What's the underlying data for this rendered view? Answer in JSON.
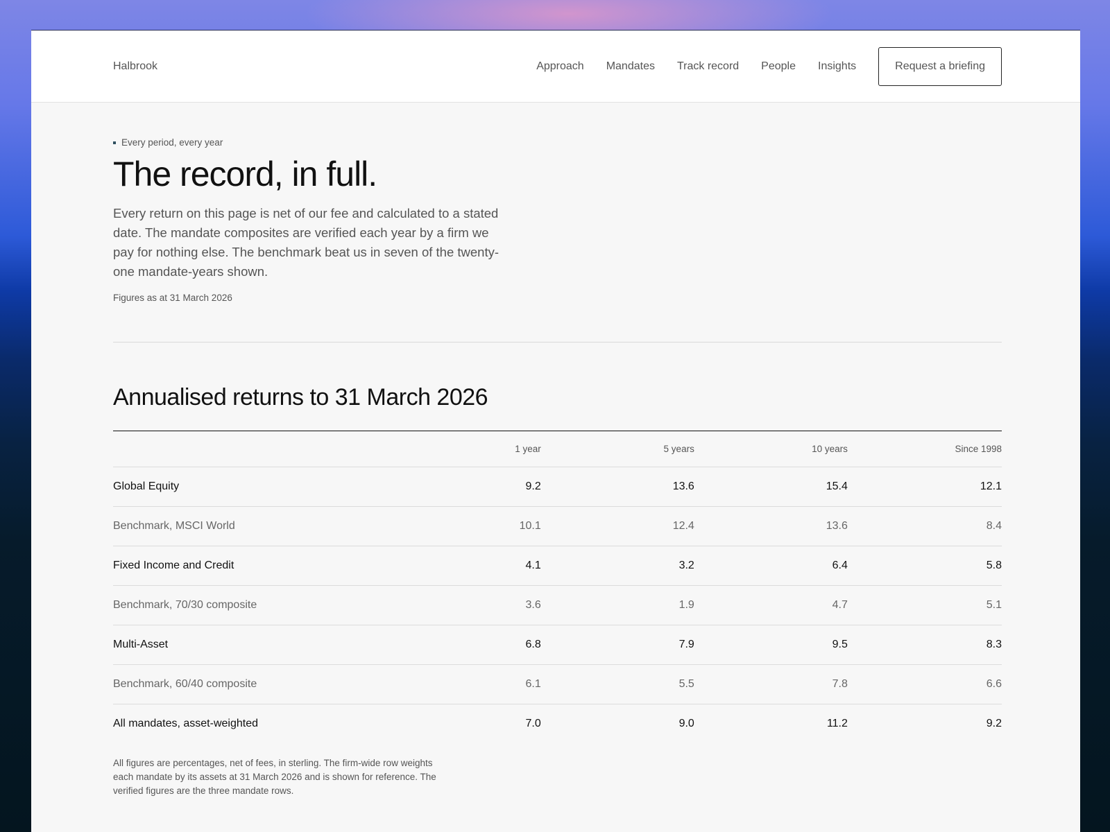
{
  "nav": {
    "brand": "Halbrook",
    "links": [
      "Approach",
      "Mandates",
      "Track record",
      "People",
      "Insights"
    ],
    "cta": "Request a briefing"
  },
  "hero": {
    "eyebrow": "Every period, every year",
    "title": "The record, in full.",
    "body": "Every return on this page is net of our fee and calculated to a stated date. The mandate composites are verified each year by a firm we pay for nothing else. The benchmark beat us in seven of the twenty-one mandate-years shown.",
    "as_at": "Figures as at 31 March 2026"
  },
  "returns": {
    "title": "Annualised returns to 31 March 2026",
    "columns": [
      "1 year",
      "5 years",
      "10 years",
      "Since 1998"
    ],
    "rows": [
      {
        "label": "Global Equity",
        "values": [
          "9.2",
          "13.6",
          "15.4",
          "12.1"
        ],
        "kind": "mandate"
      },
      {
        "label": "Benchmark, MSCI World",
        "values": [
          "10.1",
          "12.4",
          "13.6",
          "8.4"
        ],
        "kind": "benchmark"
      },
      {
        "label": "Fixed Income and Credit",
        "values": [
          "4.1",
          "3.2",
          "6.4",
          "5.8"
        ],
        "kind": "mandate"
      },
      {
        "label": "Benchmark, 70/30 composite",
        "values": [
          "3.6",
          "1.9",
          "4.7",
          "5.1"
        ],
        "kind": "benchmark"
      },
      {
        "label": "Multi-Asset",
        "values": [
          "6.8",
          "7.9",
          "9.5",
          "8.3"
        ],
        "kind": "mandate"
      },
      {
        "label": "Benchmark, 60/40 composite",
        "values": [
          "6.1",
          "5.5",
          "7.8",
          "6.6"
        ],
        "kind": "benchmark"
      },
      {
        "label": "All mandates, asset-weighted",
        "values": [
          "7.0",
          "9.0",
          "11.2",
          "9.2"
        ],
        "kind": "total"
      }
    ],
    "footnote": "All figures are percentages, net of fees, in sterling. The firm-wide row weights each mandate by its assets at 31 March 2026 and is shown for reference. The verified figures are the three mandate rows."
  }
}
